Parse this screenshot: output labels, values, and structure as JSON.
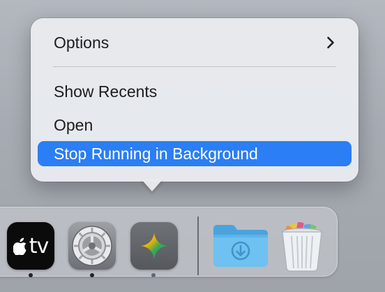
{
  "context_menu": {
    "items": [
      {
        "label": "Options",
        "has_submenu": true,
        "icon": "chevron-right-icon"
      },
      {
        "label": "Show Recents"
      },
      {
        "label": "Open"
      },
      {
        "label": "Stop Running in Background",
        "highlighted": true
      }
    ],
    "highlight_color": "#2b7ef3"
  },
  "dock": {
    "items": [
      {
        "app": "Apple TV",
        "icon": "apple-tv-icon",
        "label_text": "tv",
        "running": true
      },
      {
        "app": "System Settings",
        "icon": "gear-icon",
        "running": true
      },
      {
        "app": "Gemini",
        "icon": "gemini-sparkle-icon",
        "running": true
      },
      {
        "app": "Downloads",
        "icon": "downloads-folder-icon"
      },
      {
        "app": "Trash",
        "icon": "trash-icon"
      }
    ]
  }
}
